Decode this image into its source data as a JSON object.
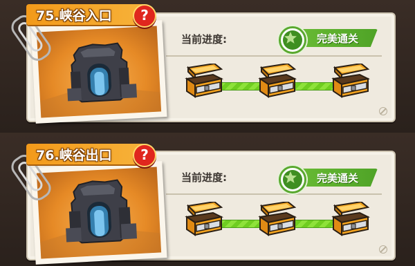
{
  "levels": [
    {
      "title": "75.峡谷入口",
      "help_symbol": "?",
      "progress_label": "当前进度:",
      "status_label": "完美通关",
      "progress_fraction": 1.0,
      "chest_count": 3,
      "chests_opened": 3
    },
    {
      "title": "76.峡谷出口",
      "help_symbol": "?",
      "progress_label": "当前进度:",
      "status_label": "完美通关",
      "progress_fraction": 1.0,
      "chest_count": 3,
      "chests_opened": 3
    }
  ],
  "colors": {
    "tag_orange": "#f39a1a",
    "help_red": "#e0261e",
    "progress_green": "#8ee23a",
    "status_green": "#4fa327",
    "chest_gold": "#f2a522",
    "card_bg": "#efeadf"
  },
  "icons": {
    "help": "question-mark-icon",
    "status": "star-badge-icon",
    "reward": "treasure-chest-icon",
    "disabled": "ban-icon",
    "attachment": "paperclip-icon"
  }
}
